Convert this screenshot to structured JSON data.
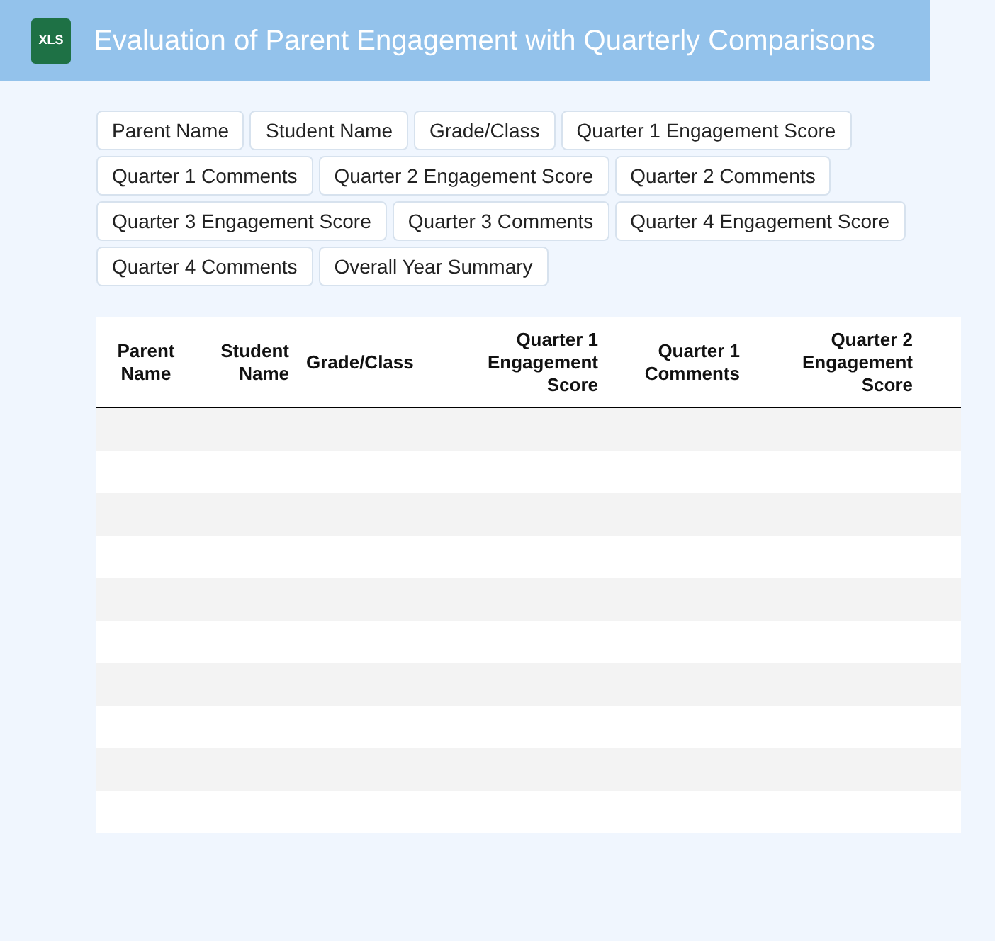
{
  "header": {
    "icon_label": "XLS",
    "title": "Evaluation of Parent Engagement with Quarterly Comparisons"
  },
  "field_chips": [
    "Parent Name",
    "Student Name",
    "Grade/Class",
    "Quarter 1 Engagement Score",
    "Quarter 1 Comments",
    "Quarter 2 Engagement Score",
    "Quarter 2 Comments",
    "Quarter 3 Engagement Score",
    "Quarter 3 Comments",
    "Quarter 4 Engagement Score",
    "Quarter 4 Comments",
    "Overall Year Summary"
  ],
  "table": {
    "columns": [
      "Parent Name",
      "Student Name",
      "Grade/Class",
      "Quarter 1 Engagement Score",
      "Quarter 1 Comments",
      "Quarter 2 Engagement Score"
    ]
  }
}
